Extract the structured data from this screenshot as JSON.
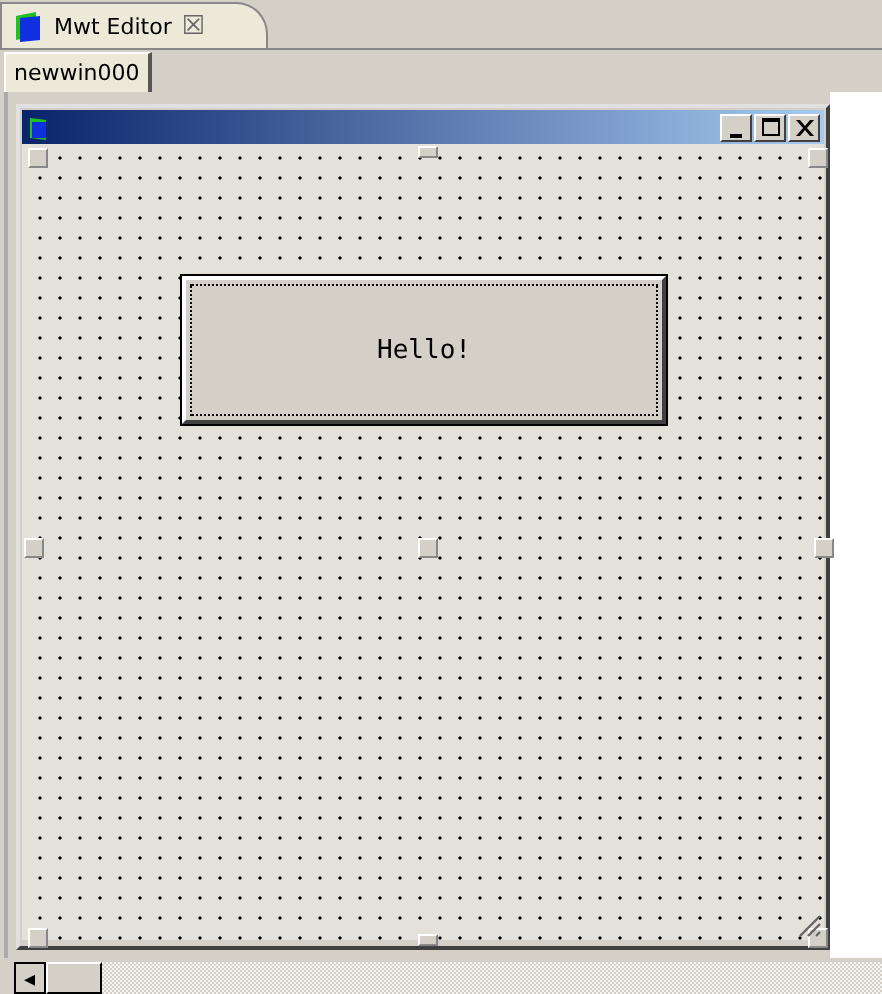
{
  "editor_tab": {
    "title": "Mwt Editor",
    "close": "☒"
  },
  "page_tabs": [
    {
      "label": "newwin000",
      "selected": true
    }
  ],
  "design_window": {
    "buttons": [
      {
        "kind": "minimize"
      },
      {
        "kind": "maximize"
      },
      {
        "kind": "close"
      }
    ],
    "widgets": [
      {
        "kind": "button",
        "label": "Hello!"
      }
    ]
  },
  "scrollbar": {
    "arrow": "◂"
  }
}
